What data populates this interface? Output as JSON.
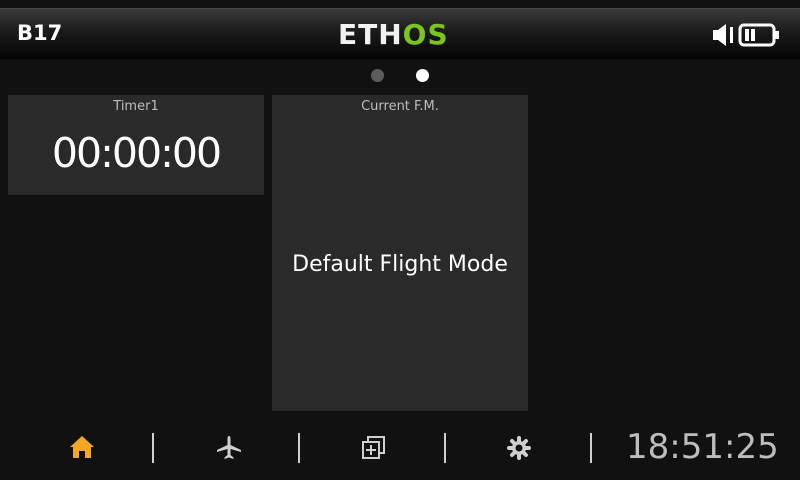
{
  "header": {
    "model_name": "B17",
    "logo_part1": "ETH",
    "logo_part2": "OS",
    "icons": [
      "speaker-icon",
      "battery-icon"
    ]
  },
  "pager": {
    "pages": 2,
    "active_page": 2
  },
  "widgets": {
    "timer": {
      "title": "Timer1",
      "value": "00:00:00"
    },
    "flight_mode": {
      "title": "Current F.M.",
      "value": "Default Flight Mode"
    }
  },
  "bottom_nav": {
    "items": [
      {
        "icon": "home-icon",
        "active": true
      },
      {
        "icon": "airplane-icon",
        "active": false
      },
      {
        "icon": "system-icon",
        "active": false
      },
      {
        "icon": "gear-icon",
        "active": false
      }
    ],
    "clock": "18:51:25"
  },
  "colors": {
    "background": "#111111",
    "widget_bg": "#2a2a2a",
    "logo_accent": "#7cc41f",
    "active_nav": "#f5a623",
    "inactive_nav": "#cfcfcf"
  }
}
